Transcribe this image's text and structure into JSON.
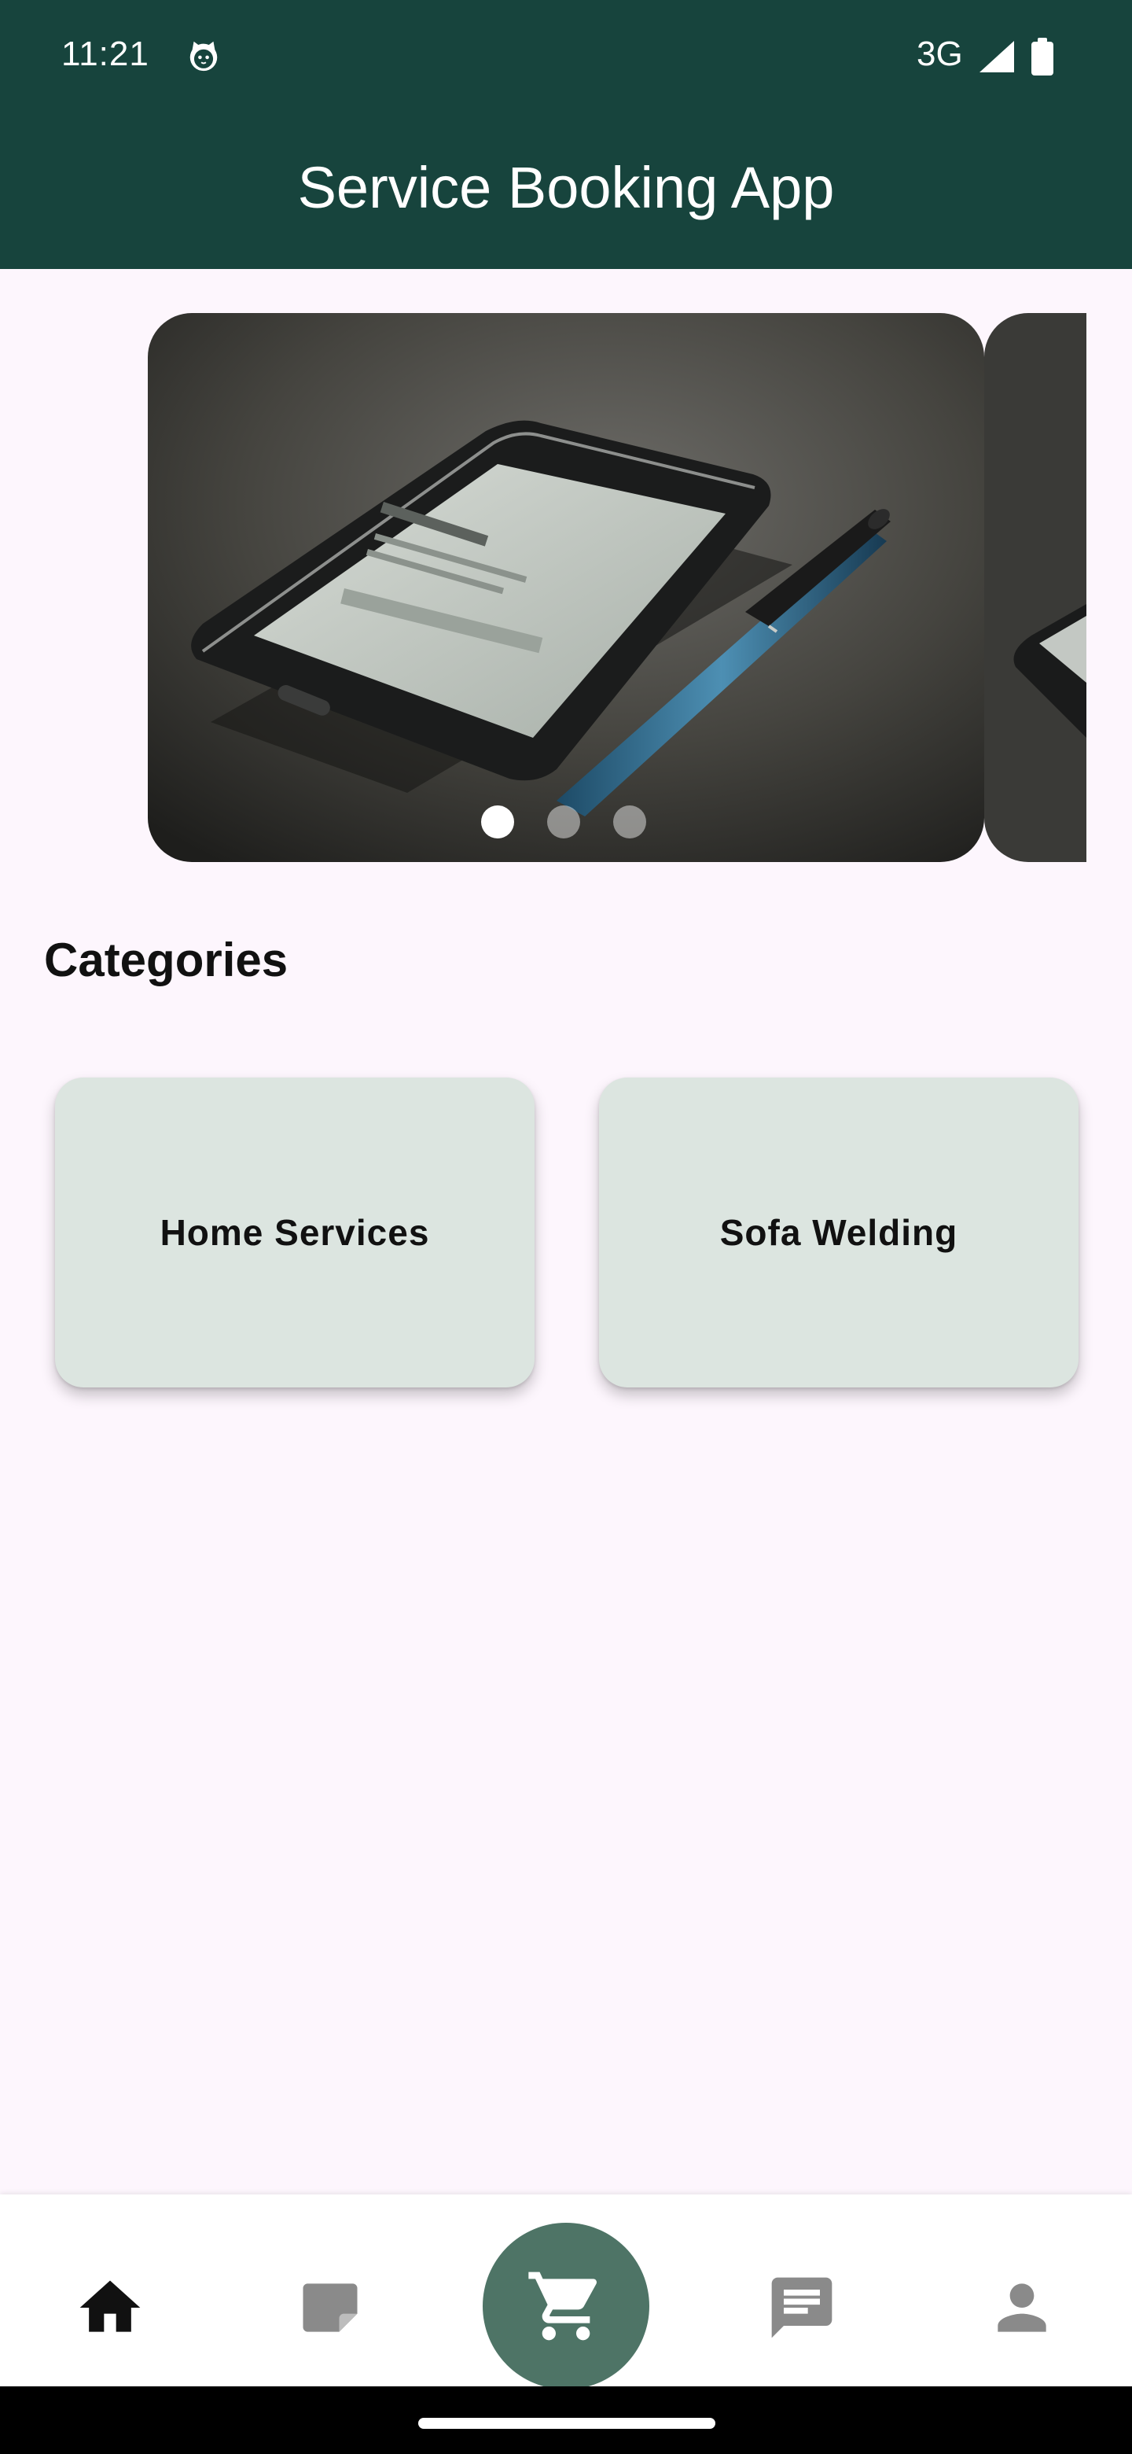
{
  "status_bar": {
    "time": "11:21",
    "network": "3G",
    "icons": [
      "cat-face-icon",
      "signal-icon",
      "battery-icon"
    ]
  },
  "app_bar": {
    "title": "Service Booking App",
    "background_color": "#17443d"
  },
  "carousel": {
    "slides": [
      "phone-and-pen-photo",
      "phone-photo"
    ],
    "dot_count": 3,
    "active_index": 0
  },
  "categories": {
    "title": "Categories",
    "items": [
      {
        "label": "Home Services"
      },
      {
        "label": "Sofa Welding"
      }
    ],
    "card_color": "#dce5e0"
  },
  "bottom_nav": {
    "items": [
      {
        "icon": "home-icon",
        "active": true
      },
      {
        "icon": "note-icon",
        "active": false
      },
      {
        "icon": "shopping-cart-icon",
        "active": false,
        "featured": true
      },
      {
        "icon": "chat-icon",
        "active": false
      },
      {
        "icon": "person-icon",
        "active": false
      }
    ],
    "accent_color": "#4e7466"
  }
}
